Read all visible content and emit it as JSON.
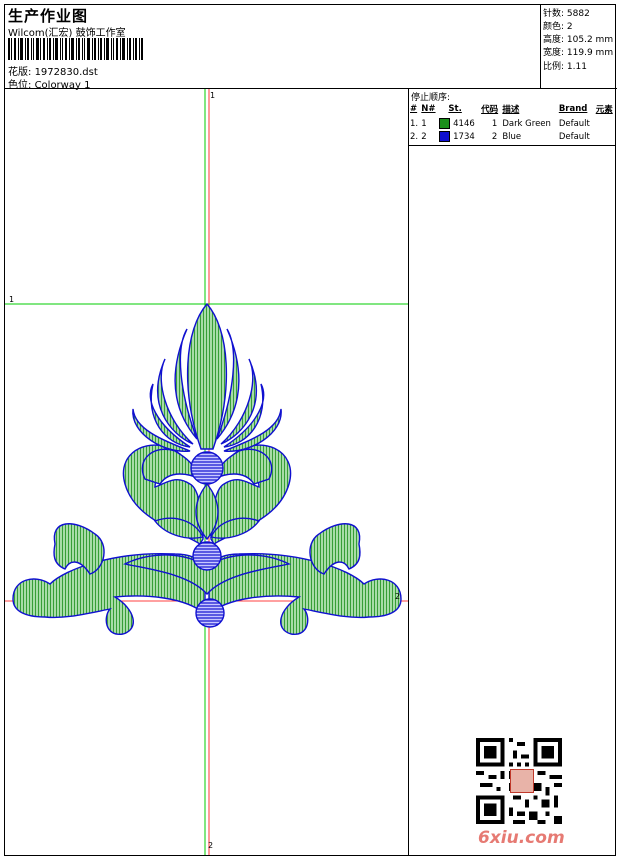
{
  "header": {
    "title": "生产作业图",
    "company": "Wilcom(汇宏) 鼓饰工作室",
    "design_label": "花版:",
    "design_value": "1972830.dst",
    "colorway_label": "色位:",
    "colorway_value": "Colorway 1"
  },
  "stats": [
    {
      "label": "针数:",
      "value": "5882"
    },
    {
      "label": "颜色:",
      "value": "2"
    },
    {
      "label": "高度:",
      "value": "105.2 mm"
    },
    {
      "label": "宽度:",
      "value": "119.9 mm"
    },
    {
      "label": "比例:",
      "value": "1.11"
    }
  ],
  "color_panel": {
    "title": "停止顺序:",
    "columns": [
      "#",
      "N#",
      "St.",
      "代码",
      "描述",
      "Brand",
      "元素"
    ],
    "rows": [
      {
        "idx": "1.",
        "n": "1",
        "swatch": "#1a8f1a",
        "st": "4146",
        "code": "1",
        "desc": "Dark Green",
        "brand": "Default"
      },
      {
        "idx": "2.",
        "n": "2",
        "swatch": "#1010d0",
        "st": "1734",
        "code": "2",
        "desc": "Blue",
        "brand": "Default"
      }
    ]
  },
  "axes": {
    "v_top": "1",
    "v_bottom": "2",
    "h_left": "1",
    "h_right": "2"
  },
  "colors": {
    "green": "#1a8f1a",
    "blue": "#1010d0",
    "guide_green": "#00cc00",
    "guide_red": "#ff0000"
  },
  "watermark": {
    "text": "6xiu.com"
  }
}
